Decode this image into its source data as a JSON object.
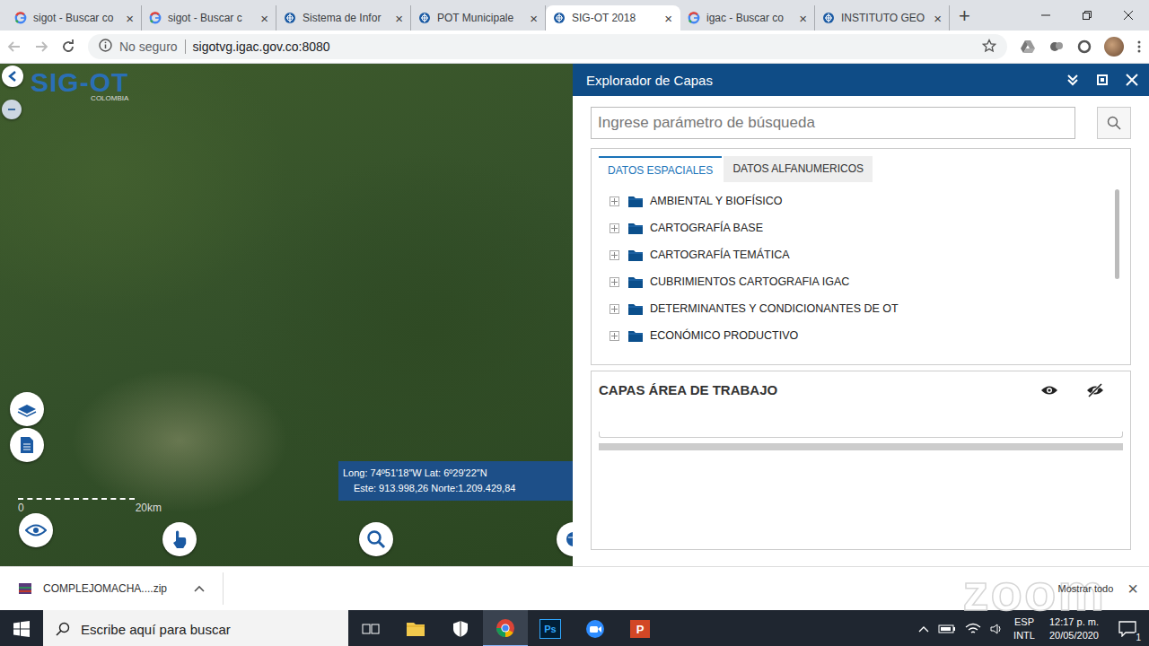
{
  "browser": {
    "tab_close": "×",
    "new_tab": "+",
    "tabs": [
      {
        "label": "sigot - Buscar co",
        "kind": "google",
        "selected": false
      },
      {
        "label": "sigot - Buscar c",
        "kind": "google",
        "selected": false
      },
      {
        "label": "Sistema de Infor",
        "kind": "igac",
        "selected": false
      },
      {
        "label": "POT Municipale",
        "kind": "igac",
        "selected": false
      },
      {
        "label": "SIG-OT 2018",
        "kind": "sigot",
        "selected": true
      },
      {
        "label": "igac - Buscar co",
        "kind": "google",
        "selected": false
      },
      {
        "label": "INSTITUTO GEO",
        "kind": "igac",
        "selected": false
      }
    ],
    "address": {
      "security": "No seguro",
      "url": "sigotvg.igac.gov.co:8080"
    }
  },
  "map": {
    "logo": {
      "title": "SIG-OT",
      "subtitle": "COLOMBIA"
    },
    "coordinates": {
      "geo": "Long: 74º51'18″W Lat: 6º29'22″N",
      "plane": "Este: 913.998,26 Norte:1.209.429,84"
    },
    "scale": {
      "start": "0",
      "end": "20km"
    }
  },
  "panel": {
    "title": "Explorador de Capas",
    "search": {
      "placeholder": "Ingrese parámetro de búsqueda"
    },
    "tabs": [
      {
        "label": "DATOS ESPACIALES",
        "selected": true
      },
      {
        "label": "DATOS ALFANUMERICOS",
        "selected": false
      }
    ],
    "folders": [
      {
        "label": "AMBIENTAL Y BIOFÍSICO",
        "expanded": false
      },
      {
        "label": "CARTOGRAFÍA BASE",
        "expanded": false
      },
      {
        "label": "CARTOGRAFÍA TEMÁTICA",
        "expanded": false
      },
      {
        "label": "CUBRIMIENTOS CARTOGRAFIA IGAC",
        "expanded": false
      },
      {
        "label": "DETERMINANTES Y CONDICIONANTES DE OT",
        "expanded": false
      },
      {
        "label": "ECONÓMICO PRODUCTIVO",
        "expanded": false
      }
    ],
    "work_area": {
      "title": "CAPAS ÁREA DE TRABAJO"
    }
  },
  "download": {
    "file": "COMPLEJOMACHA....zip",
    "show_all": "Mostrar todo",
    "close": "×"
  },
  "watermark": "zoom",
  "taskbar": {
    "search": "Escribe aquí para buscar",
    "apps": [
      {
        "kind": "taskview",
        "active": false
      },
      {
        "kind": "explorer",
        "active": false
      },
      {
        "kind": "security",
        "active": false
      },
      {
        "kind": "chrome",
        "active": true
      },
      {
        "kind": "photoshop",
        "active": false
      },
      {
        "kind": "zoom",
        "active": false
      },
      {
        "kind": "powerpoint",
        "active": false
      }
    ],
    "photoshop_label": "Ps",
    "powerpoint_label": "P",
    "language": "ESP",
    "layout": "INTL",
    "time": "12:17 p. m.",
    "date": "20/05/2020",
    "notifications": "1"
  }
}
